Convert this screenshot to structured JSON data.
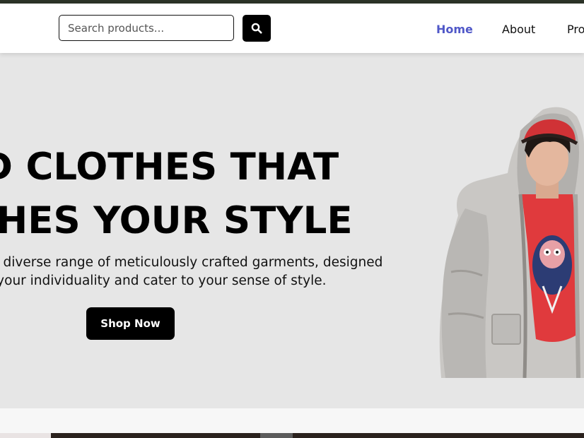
{
  "search": {
    "placeholder": "Search products..."
  },
  "nav": {
    "links": [
      {
        "label": "Home",
        "active": true
      },
      {
        "label": "About",
        "active": false
      },
      {
        "label": "Pro",
        "active": false
      }
    ]
  },
  "hero": {
    "headline_line1": "D CLOTHES THAT",
    "headline_line2": "CHES YOUR STYLE",
    "subtext_line1": "our diverse range of meticulously crafted garments, designed",
    "subtext_line2": "out your individuality and cater to your sense of style.",
    "cta_label": "Shop Now"
  },
  "colors": {
    "topbar": "#2c3328",
    "hero_background": "#e6e6e6",
    "nav_active": "#5058c8",
    "button": "#000000"
  },
  "icons": {
    "search": "search-icon"
  }
}
